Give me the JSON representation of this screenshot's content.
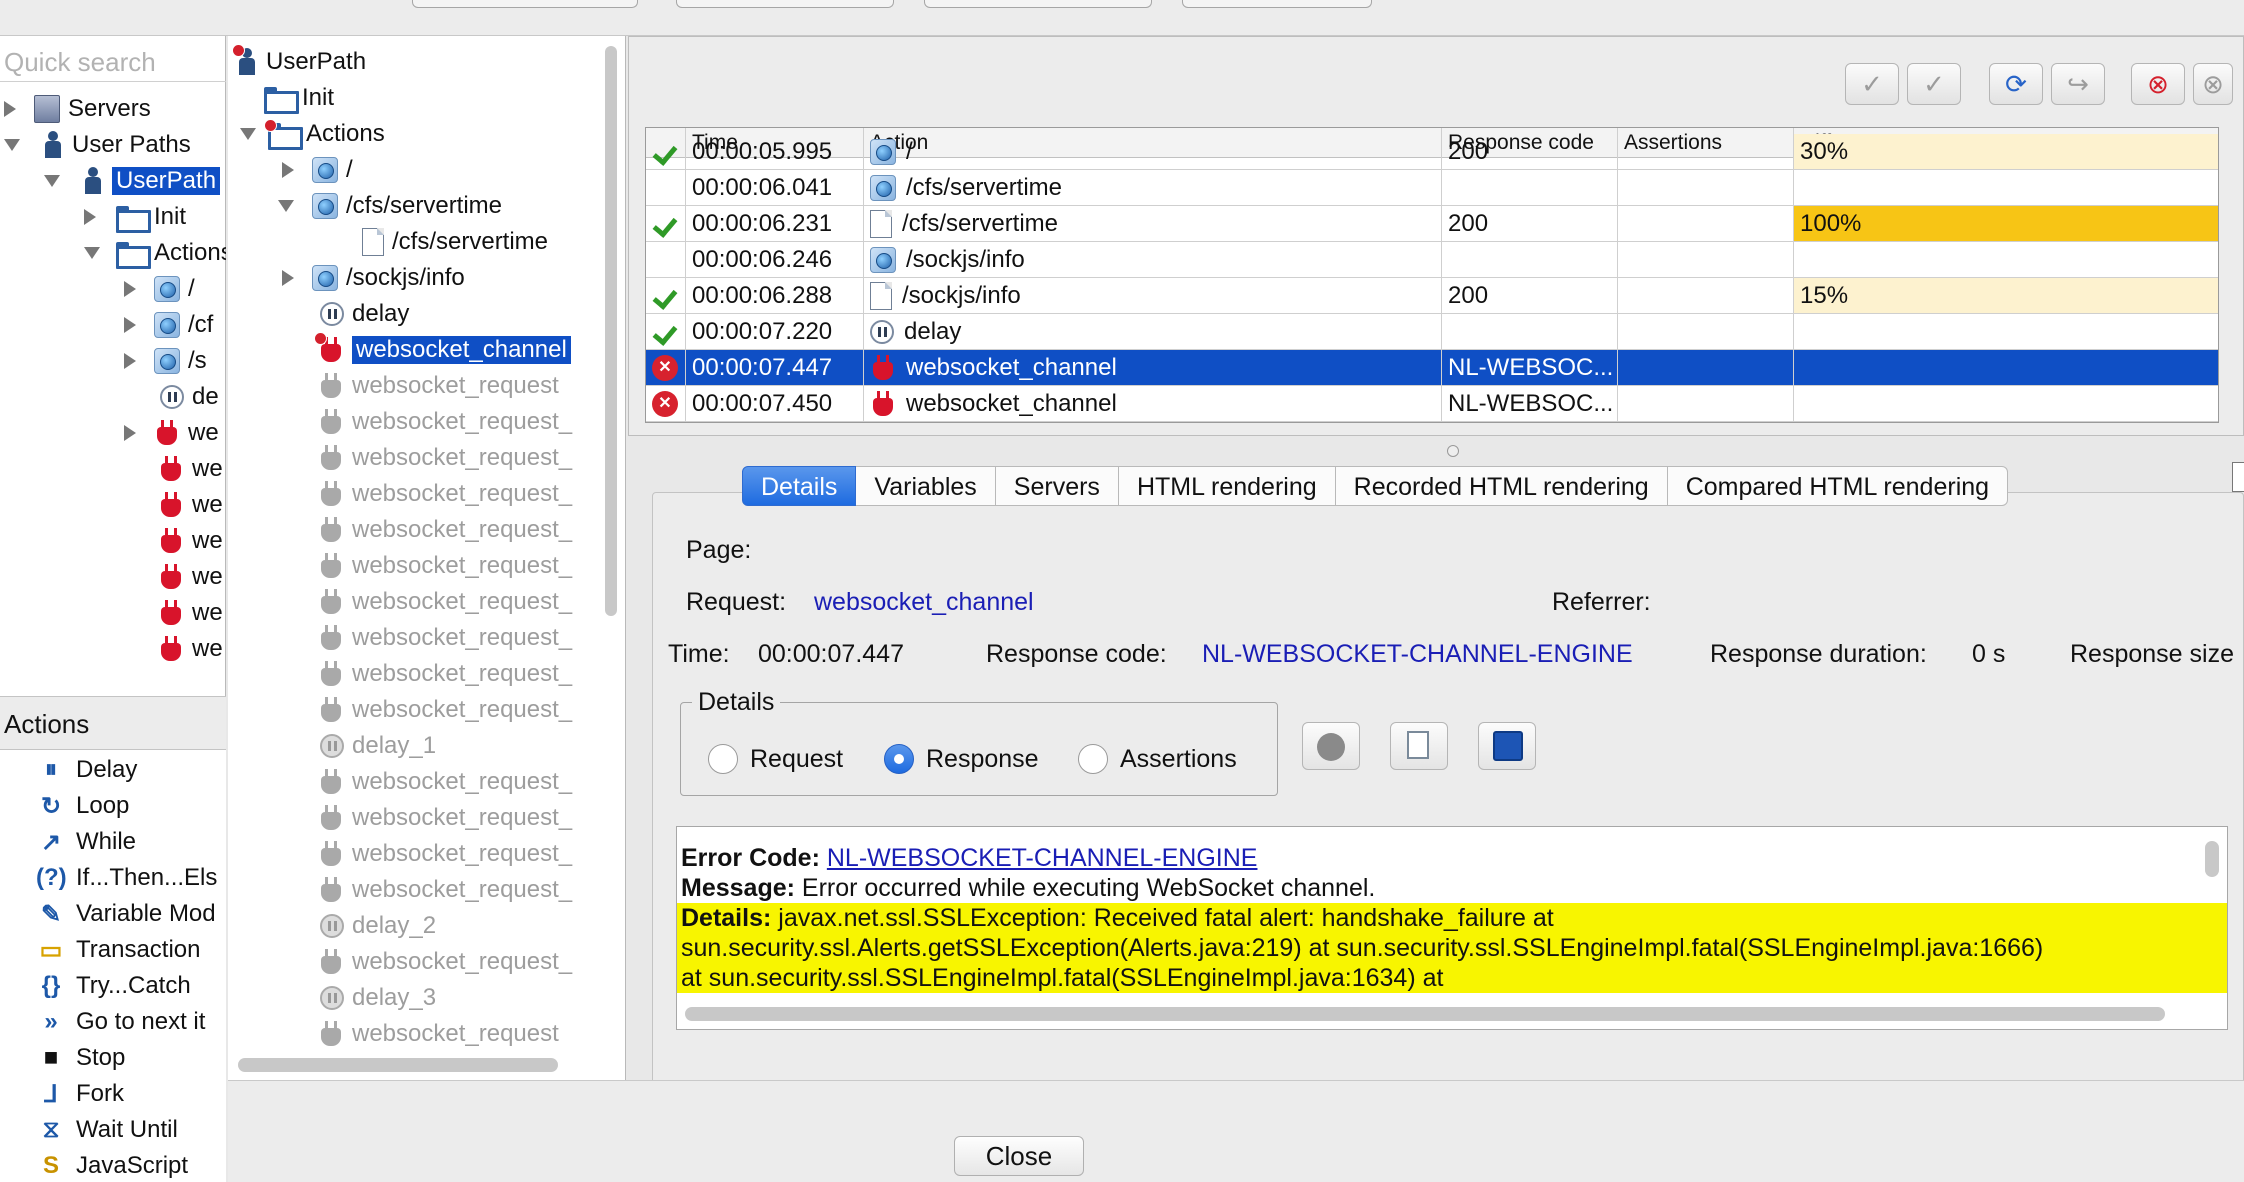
{
  "left": {
    "search_placeholder": "Quick search",
    "tree": [
      {
        "label": "Servers"
      },
      {
        "label": "User Paths"
      },
      {
        "label": "UserPath"
      },
      {
        "label": "Init"
      },
      {
        "label": "Actions"
      },
      {
        "label": "/"
      },
      {
        "label": "/cf"
      },
      {
        "label": "/s"
      },
      {
        "label": "de"
      },
      {
        "label": "we"
      },
      {
        "label": "we"
      },
      {
        "label": "we"
      },
      {
        "label": "we"
      },
      {
        "label": "we"
      },
      {
        "label": "we"
      },
      {
        "label": "we"
      }
    ],
    "actions_header": "Actions",
    "actions": [
      {
        "label": "Delay",
        "glyph": "⏸"
      },
      {
        "label": "Loop",
        "glyph": "↻"
      },
      {
        "label": "While",
        "glyph": "↗"
      },
      {
        "label": "If...Then...Els",
        "glyph": "(?)"
      },
      {
        "label": "Variable Mod",
        "glyph": "✎"
      },
      {
        "label": "Transaction",
        "glyph": "▭"
      },
      {
        "label": "Try...Catch",
        "glyph": "{}"
      },
      {
        "label": "Go to next it",
        "glyph": "»"
      },
      {
        "label": "Stop",
        "glyph": "■"
      },
      {
        "label": "Fork",
        "glyph": "⅃"
      },
      {
        "label": "Wait Until",
        "glyph": "⧖"
      },
      {
        "label": "JavaScript",
        "glyph": "S"
      }
    ]
  },
  "mid": {
    "items": [
      {
        "label": "UserPath"
      },
      {
        "label": "Init"
      },
      {
        "label": "Actions"
      },
      {
        "label": "/"
      },
      {
        "label": "/cfs/servertime"
      },
      {
        "label": "/cfs/servertime"
      },
      {
        "label": "/sockjs/info"
      },
      {
        "label": "delay"
      },
      {
        "label": "websocket_channel"
      },
      {
        "label": "websocket_request"
      },
      {
        "label": "websocket_request_"
      },
      {
        "label": "websocket_request_"
      },
      {
        "label": "websocket_request_"
      },
      {
        "label": "websocket_request_"
      },
      {
        "label": "websocket_request_"
      },
      {
        "label": "websocket_request_"
      },
      {
        "label": "websocket_request_"
      },
      {
        "label": "websocket_request_"
      },
      {
        "label": "websocket_request_"
      },
      {
        "label": "delay_1"
      },
      {
        "label": "websocket_request_"
      },
      {
        "label": "websocket_request_"
      },
      {
        "label": "websocket_request_"
      },
      {
        "label": "websocket_request_"
      },
      {
        "label": "delay_2"
      },
      {
        "label": "websocket_request_"
      },
      {
        "label": "delay_3"
      },
      {
        "label": "websocket_request"
      }
    ]
  },
  "grid": {
    "columns": [
      "Time",
      "Action",
      "Response code",
      "Assertions",
      "Difference"
    ],
    "rows": [
      {
        "time": "00:00:05.995",
        "action": "/",
        "code": "200",
        "assert": "",
        "diff": "30%"
      },
      {
        "time": "00:00:06.041",
        "action": "/cfs/servertime",
        "code": "",
        "assert": "",
        "diff": ""
      },
      {
        "time": "00:00:06.231",
        "action": "/cfs/servertime",
        "code": "200",
        "assert": "",
        "diff": "100%"
      },
      {
        "time": "00:00:06.246",
        "action": "/sockjs/info",
        "code": "",
        "assert": "",
        "diff": ""
      },
      {
        "time": "00:00:06.288",
        "action": "/sockjs/info",
        "code": "200",
        "assert": "",
        "diff": "15%"
      },
      {
        "time": "00:00:07.220",
        "action": "delay",
        "code": "",
        "assert": "",
        "diff": ""
      },
      {
        "time": "00:00:07.447",
        "action": "websocket_channel",
        "code": "NL-WEBSOC...",
        "assert": "",
        "diff": ""
      },
      {
        "time": "00:00:07.450",
        "action": "websocket_channel",
        "code": "NL-WEBSOC...",
        "assert": "",
        "diff": ""
      }
    ]
  },
  "tabs": [
    "Details",
    "Variables",
    "Servers",
    "HTML rendering",
    "Recorded HTML rendering",
    "Compared HTML rendering"
  ],
  "details": {
    "page_label": "Page:",
    "request_label": "Request:",
    "request_value": "websocket_channel",
    "referrer_label": "Referrer:",
    "time_label": "Time:",
    "time_value": "00:00:07.447",
    "code_label": "Response code:",
    "code_value": "NL-WEBSOCKET-CHANNEL-ENGINE",
    "duration_label": "Response duration:",
    "duration_value": "0 s",
    "size_label": "Response size",
    "group_title": "Details",
    "radios": [
      "Request",
      "Response",
      "Assertions"
    ]
  },
  "response": {
    "error_code_label": "Error Code:",
    "error_code_value": "NL-WEBSOCKET-CHANNEL-ENGINE",
    "message_label": "Message:",
    "message_value": "Error occurred while executing WebSocket channel.",
    "details_label": "Details:",
    "details_line1": "javax.net.ssl.SSLException: Received fatal alert: handshake_failure at",
    "details_line2": "sun.security.ssl.Alerts.getSSLException(Alerts.java:219) at sun.security.ssl.SSLEngineImpl.fatal(SSLEngineImpl.java:1666)",
    "details_line3": "at sun.security.ssl.SSLEngineImpl.fatal(SSLEngineImpl.java:1634) at"
  },
  "close_label": "Close"
}
